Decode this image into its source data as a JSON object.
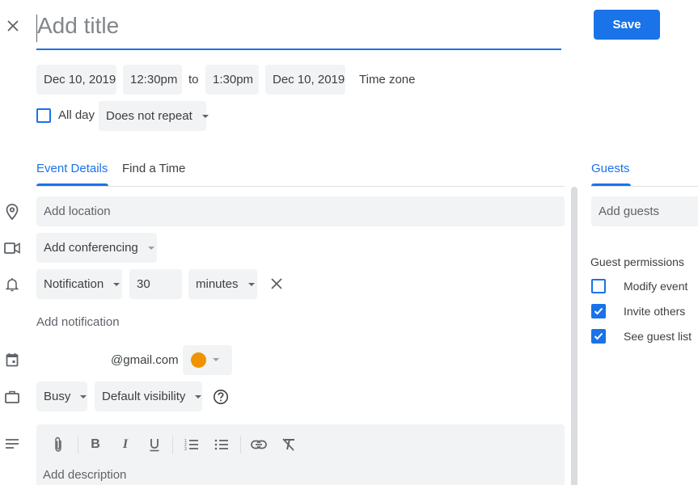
{
  "header": {
    "title_placeholder": "Add title",
    "save_label": "Save",
    "close_icon": "close-icon"
  },
  "datetime": {
    "start_date": "Dec 10, 2019",
    "start_time": "12:30pm",
    "separator": "to",
    "end_time": "1:30pm",
    "end_date": "Dec 10, 2019",
    "time_zone_label": "Time zone"
  },
  "options": {
    "all_day_label": "All day",
    "all_day_checked": false,
    "repeat_value": "Does not repeat"
  },
  "tabs": [
    {
      "label": "Event Details",
      "active": true
    },
    {
      "label": "Find a Time",
      "active": false
    }
  ],
  "details": {
    "location_placeholder": "Add location",
    "conferencing_label": "Add conferencing",
    "notification": {
      "type": "Notification",
      "amount": "30",
      "unit": "minutes"
    },
    "add_notification_label": "Add notification",
    "calendar_owner": "@gmail.com",
    "calendar_color": "#f09300",
    "availability": "Busy",
    "visibility": "Default visibility",
    "description_placeholder": "Add description",
    "toolbar": [
      "attach-icon",
      "bold-icon",
      "italic-icon",
      "underline-icon",
      "numbered-list-icon",
      "bulleted-list-icon",
      "link-icon",
      "remove-formatting-icon"
    ]
  },
  "guests": {
    "tab_label": "Guests",
    "input_placeholder": "Add guests",
    "permissions_title": "Guest permissions",
    "permissions": [
      {
        "label": "Modify event",
        "checked": false
      },
      {
        "label": "Invite others",
        "checked": true
      },
      {
        "label": "See guest list",
        "checked": true
      }
    ]
  },
  "colors": {
    "accent": "#1a73e8",
    "chip_bg": "#f1f3f4",
    "text": "#3c4043"
  }
}
